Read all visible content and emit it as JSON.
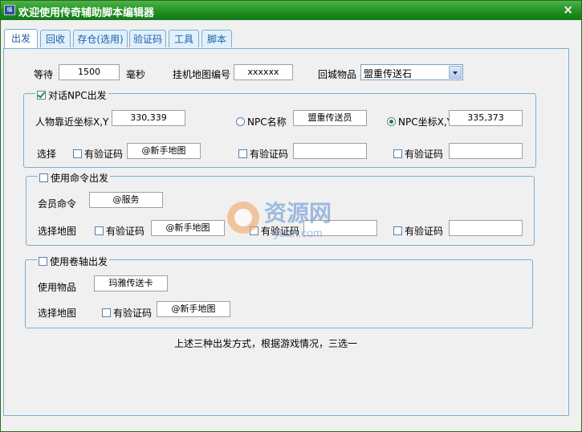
{
  "window": {
    "title": "欢迎使用传奇辅助脚本编辑器",
    "icon_text": "编",
    "close_glyph": "×"
  },
  "tabs": [
    {
      "label": "出发",
      "active": true
    },
    {
      "label": "回收"
    },
    {
      "label": "存仓(选用)"
    },
    {
      "label": "验证码"
    },
    {
      "label": "工具"
    },
    {
      "label": "脚本"
    }
  ],
  "top_row": {
    "wait_label": "等待",
    "wait_value": "1500",
    "ms_label": "毫秒",
    "map_label": "挂机地图编号",
    "map_value": "xxxxxx",
    "return_item_label": "回城物品",
    "return_item_value": "盟重传送石"
  },
  "npc_group": {
    "title": "对话NPC出发",
    "checked": true,
    "coord_label": "人物靠近坐标X,Y",
    "coord_value": "330,339",
    "npc_name_radio": "NPC名称",
    "npc_name_value": "盟重传送员",
    "npc_coord_radio": "NPC坐标X,Y",
    "npc_coord_value": "335,373",
    "select_label": "选择",
    "captcha1_label": "有验证码",
    "map1_value": "@新手地图",
    "captcha2_label": "有验证码",
    "map2_value": "",
    "captcha3_label": "有验证码",
    "map3_value": ""
  },
  "cmd_group": {
    "title": "使用命令出发",
    "member_cmd_label": "会员命令",
    "member_cmd_value": "@服务",
    "select_map_label": "选择地图",
    "captcha1_label": "有验证码",
    "map1_value": "@新手地图",
    "captcha2_label": "有验证码",
    "map2_value": "",
    "captcha3_label": "有验证码",
    "map3_value": ""
  },
  "scroll_group": {
    "title": "使用卷轴出发",
    "item_label": "使用物品",
    "item_value": "玛雅传送卡",
    "select_map_label": "选择地图",
    "captcha_label": "有验证码",
    "map_value": "@新手地图"
  },
  "footer_note": "上述三种出发方式，根据游戏情况，三选一",
  "watermark": {
    "text": "资源网",
    "sub": "yuan.com"
  }
}
